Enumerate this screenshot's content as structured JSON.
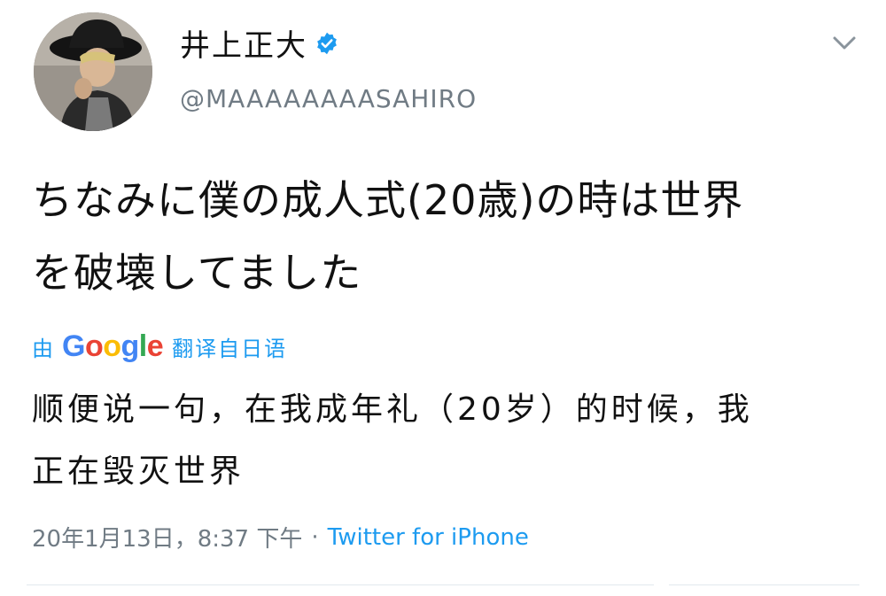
{
  "user": {
    "display_name": "井上正大",
    "handle": "@MAAAAAAAASAHIRO",
    "verified_icon": "verified-badge-icon",
    "avatar_icon": "profile-photo"
  },
  "menu_icon": "chevron-down-icon",
  "tweet": {
    "text_line1": "ちなみに僕の成人式(20歳)の時は世界",
    "text_line2": "を破壊してました"
  },
  "translation": {
    "prefix": "由",
    "brand": [
      "G",
      "o",
      "o",
      "g",
      "l",
      "e"
    ],
    "suffix": "翻译自日语",
    "text_line1": "顺便说一句，在我成年礼（20岁）的时候，我",
    "text_line2": "正在毁灭世界"
  },
  "meta": {
    "timestamp": "20年1月13日，8:37 下午",
    "separator": "·",
    "source": "Twitter for iPhone"
  },
  "colors": {
    "accent": "#1d9bf0",
    "secondary_text": "#707b84",
    "google_blue": "#4285f4",
    "google_red": "#ea4335",
    "google_yellow": "#fbbc05",
    "google_green": "#34a853"
  }
}
